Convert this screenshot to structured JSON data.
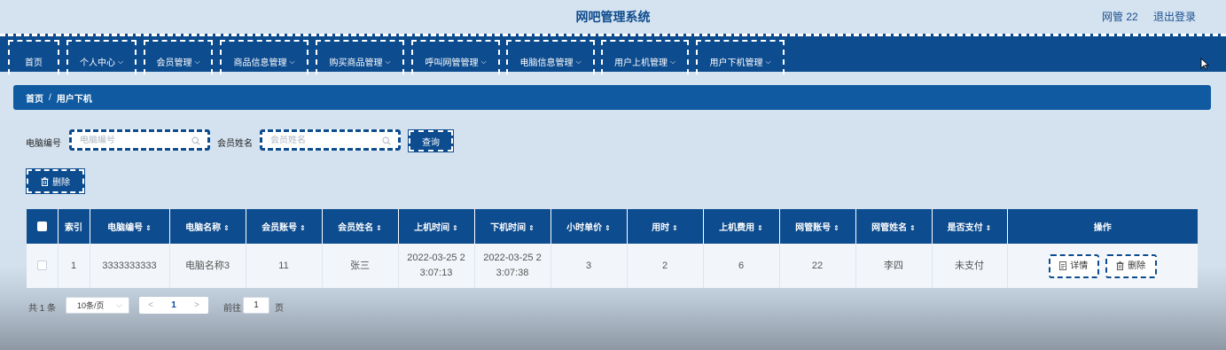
{
  "header": {
    "title": "网吧管理系统",
    "user": "网管 22",
    "logout": "退出登录"
  },
  "nav": {
    "items": [
      {
        "label": "首页",
        "has_dropdown": false
      },
      {
        "label": "个人中心",
        "has_dropdown": true
      },
      {
        "label": "会员管理",
        "has_dropdown": true
      },
      {
        "label": "商品信息管理",
        "has_dropdown": true
      },
      {
        "label": "购买商品管理",
        "has_dropdown": true
      },
      {
        "label": "呼叫网管管理",
        "has_dropdown": true
      },
      {
        "label": "电脑信息管理",
        "has_dropdown": true
      },
      {
        "label": "用户上机管理",
        "has_dropdown": true
      },
      {
        "label": "用户下机管理",
        "has_dropdown": true
      }
    ]
  },
  "breadcrumb": {
    "home": "首页",
    "separator": "/",
    "current": "用户下机"
  },
  "search": {
    "computer_no_label": "电脑编号",
    "computer_no_placeholder": "电脑编号",
    "member_name_label": "会员姓名",
    "member_name_placeholder": "会员姓名",
    "query_button": "查询"
  },
  "toolbar": {
    "delete_label": "删除"
  },
  "table": {
    "columns": [
      "",
      "索引",
      "电脑编号",
      "电脑名称",
      "会员账号",
      "会员姓名",
      "上机时间",
      "下机时间",
      "小时单价",
      "用时",
      "上机费用",
      "网管账号",
      "网管姓名",
      "是否支付",
      "操作"
    ],
    "sortable": [
      false,
      false,
      true,
      true,
      true,
      true,
      true,
      true,
      true,
      true,
      true,
      true,
      true,
      true,
      false
    ],
    "rows": [
      {
        "index": "1",
        "computer_no": "3333333333",
        "computer_name": "电脑名称3",
        "member_account": "11",
        "member_name": "张三",
        "start_time_1": "2022-03-25 2",
        "start_time_2": "3:07:13",
        "end_time_1": "2022-03-25 2",
        "end_time_2": "3:07:38",
        "hourly_price": "3",
        "duration": "2",
        "fee": "6",
        "admin_account": "22",
        "admin_name": "李四",
        "paid": "未支付",
        "detail_label": "详情",
        "delete_label": "删除"
      }
    ]
  },
  "pagination": {
    "total": "共 1 条",
    "page_size": "10条/页",
    "prev": "<",
    "current_page": "1",
    "next": ">",
    "goto_label": "前往",
    "goto_value": "1",
    "page_unit": "页"
  },
  "colors": {
    "primary": "#0d4c8f",
    "breadcrumb": "#0f5aa0",
    "background": "#d6e4f1"
  }
}
